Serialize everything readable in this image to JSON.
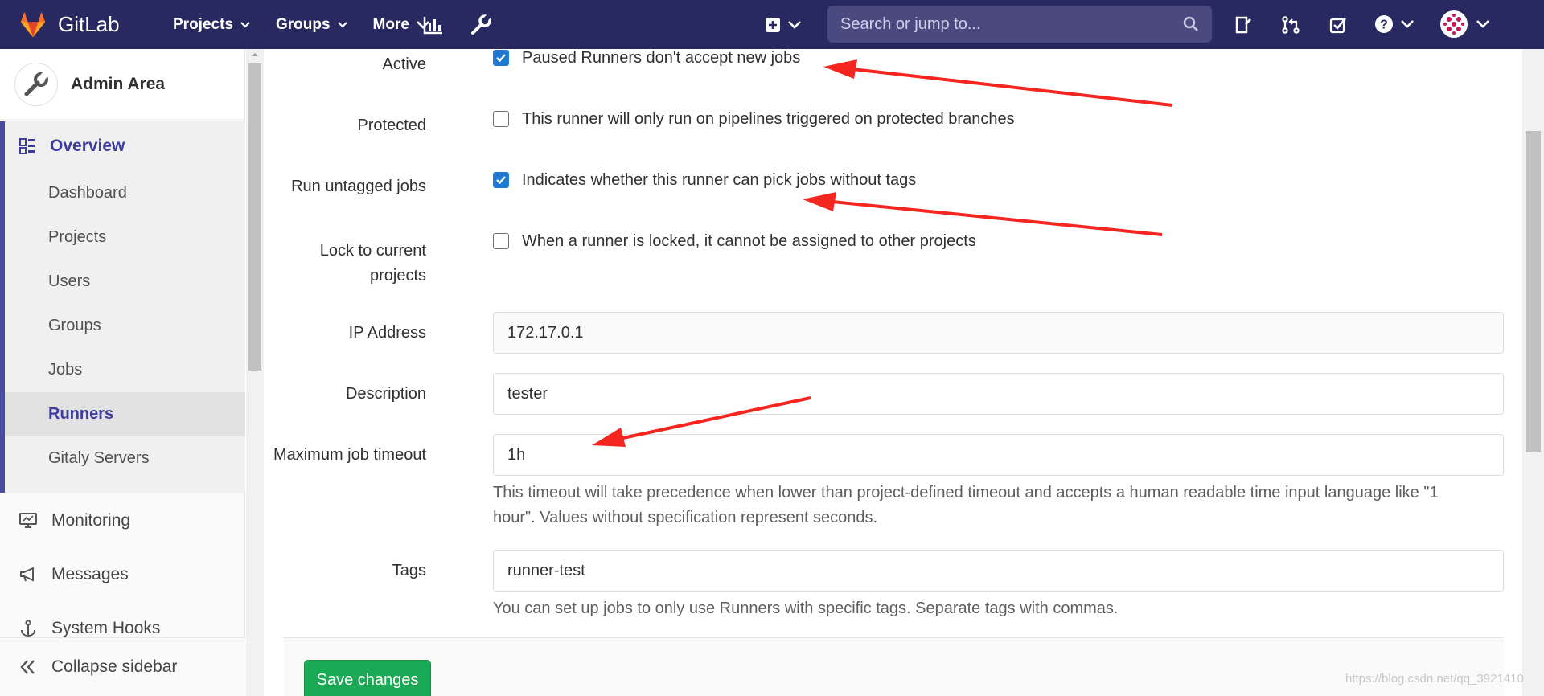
{
  "nav": {
    "brand": "GitLab",
    "projects": "Projects",
    "groups": "Groups",
    "more": "More",
    "search_placeholder": "Search or jump to..."
  },
  "sidebar": {
    "title": "Admin Area",
    "overview": "Overview",
    "items": [
      "Dashboard",
      "Projects",
      "Users",
      "Groups",
      "Jobs",
      "Runners",
      "Gitaly Servers"
    ],
    "active_item": "Runners",
    "monitoring": "Monitoring",
    "messages": "Messages",
    "system_hooks": "System Hooks",
    "collapse": "Collapse sidebar"
  },
  "form": {
    "active": {
      "label": "Active",
      "text": "Paused Runners don't accept new jobs",
      "checked": true
    },
    "protected": {
      "label": "Protected",
      "text": "This runner will only run on pipelines triggered on protected branches",
      "checked": false
    },
    "untagged": {
      "label": "Run untagged jobs",
      "text": "Indicates whether this runner can pick jobs without tags",
      "checked": true
    },
    "locked": {
      "label_line1": "Lock to current",
      "label_line2": "projects",
      "text": "When a runner is locked, it cannot be assigned to other projects",
      "checked": false
    },
    "ip": {
      "label": "IP Address",
      "value": "172.17.0.1"
    },
    "description": {
      "label": "Description",
      "value": "tester"
    },
    "timeout": {
      "label": "Maximum job timeout",
      "value": "1h",
      "help_line1": "This timeout will take precedence when lower than project-defined timeout and accepts a human readable time input language like \"1",
      "help_line2": "hour\". Values without specification represent seconds."
    },
    "tags": {
      "label": "Tags",
      "value": "runner-test",
      "help": "You can set up jobs to only use Runners with specific tags. Separate tags with commas."
    },
    "save": "Save changes"
  },
  "watermark": "https://blog.csdn.net/qq_3921410",
  "colors": {
    "nav_bg": "#292961",
    "accent": "#3c3c9e",
    "save": "#1aaa55",
    "annotation": "#f5251f"
  }
}
